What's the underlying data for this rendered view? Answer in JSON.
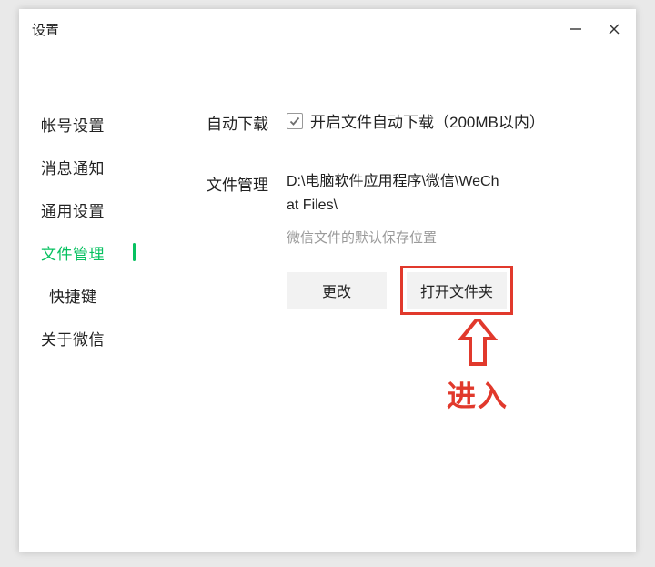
{
  "window": {
    "title": "设置"
  },
  "sidebar": {
    "items": [
      {
        "label": "帐号设置",
        "selected": false
      },
      {
        "label": "消息通知",
        "selected": false
      },
      {
        "label": "通用设置",
        "selected": false
      },
      {
        "label": "文件管理",
        "selected": true
      },
      {
        "label": "快捷键",
        "selected": false
      },
      {
        "label": "关于微信",
        "selected": false
      }
    ]
  },
  "content": {
    "auto_download": {
      "label": "自动下载",
      "checkbox_label": "开启文件自动下载（200MB以内）",
      "checked": true
    },
    "file_management": {
      "label": "文件管理",
      "path": "D:\\电脑软件应用程序\\微信\\WeChat Files\\",
      "hint": "微信文件的默认保存位置",
      "change_button": "更改",
      "open_folder_button": "打开文件夹"
    }
  },
  "annotation": {
    "text": "进入"
  }
}
